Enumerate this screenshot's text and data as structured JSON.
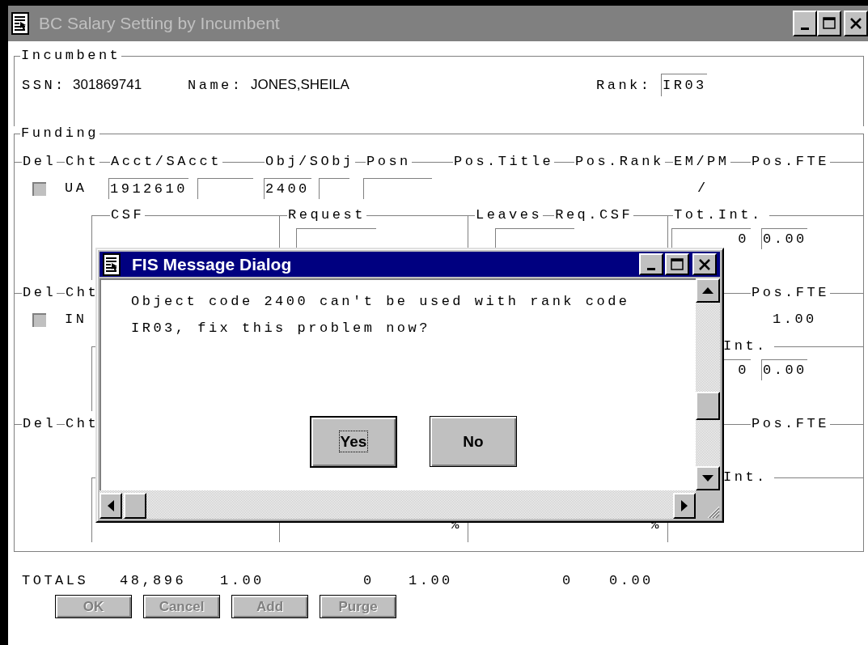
{
  "window": {
    "title": "BC Salary Setting by Incumbent",
    "active": false
  },
  "incumbent": {
    "group_label": "Incumbent",
    "ssn_label": "SSN:",
    "ssn": "301869741",
    "name_label": "Name:",
    "name": "JONES,SHEILA",
    "rank_label": "Rank:",
    "rank": "IR03"
  },
  "funding": {
    "group_label": "Funding",
    "rows": [
      {
        "kind": "full",
        "headers": [
          "Del",
          "Cht",
          "Acct/SAcct",
          "Obj/SObj",
          "Posn",
          "Pos.Title",
          "Pos.Rank",
          "EM/PM",
          "Pos.FTE"
        ],
        "checked": false,
        "chart": "UA",
        "acct": "1912610",
        "obj": "2400",
        "em_pm": "/",
        "sub_headers": [
          "CSF",
          "Request",
          "Leaves",
          "Req.CSF",
          "Tot.Int."
        ],
        "tot_int": "0",
        "tot_int_fte": "0.00"
      },
      {
        "kind": "covered",
        "headers": [
          "Del",
          "Cht",
          "Pos.FTE"
        ],
        "checked": false,
        "chart": "IN",
        "pos_fte": "1.00",
        "sub_headers": [
          "Int."
        ],
        "tot_int": "0",
        "tot_int_fte": "0.00"
      },
      {
        "kind": "covered",
        "headers": [
          "Del",
          "Cht",
          "Pos.FTE"
        ],
        "sub_headers": [
          "Int."
        ],
        "percent_marks": [
          "%",
          "%"
        ]
      }
    ]
  },
  "totals": {
    "label": "TOTALS",
    "values": [
      "48,896",
      "1.00",
      "0",
      "1.00",
      "0",
      "0.00"
    ]
  },
  "buttons": [
    {
      "label": "OK",
      "disabled": true
    },
    {
      "label": "Cancel",
      "disabled": true
    },
    {
      "label": "Add",
      "disabled": true
    },
    {
      "label": "Purge",
      "disabled": true
    }
  ],
  "dialog": {
    "title": "FIS Message Dialog",
    "active": true,
    "message": "Object code 2400 can't be used with rank code IR03, fix this problem now?",
    "buttons": [
      {
        "label": "Yes",
        "default": true
      },
      {
        "label": "No",
        "default": false
      }
    ]
  }
}
